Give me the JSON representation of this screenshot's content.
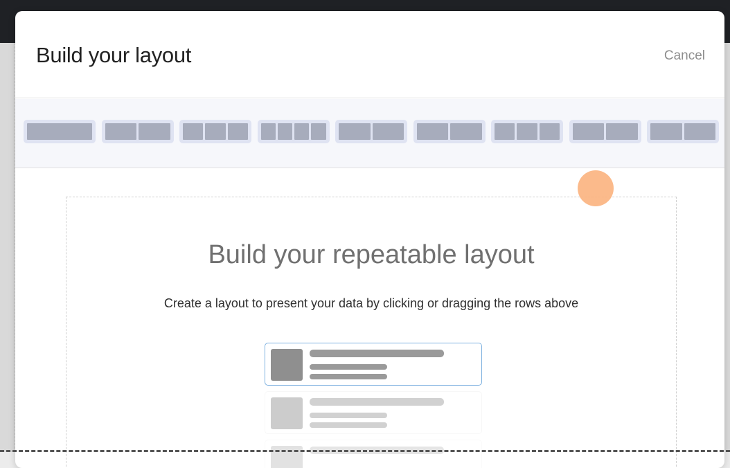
{
  "modal": {
    "title": "Build your layout",
    "cancel_label": "Cancel"
  },
  "palette": {
    "row_options": [
      {
        "name": "row-option-1",
        "segments": 1
      },
      {
        "name": "row-option-2",
        "segments": 2
      },
      {
        "name": "row-option-3",
        "segments": 3
      },
      {
        "name": "row-option-4",
        "segments": 4
      },
      {
        "name": "row-option-5",
        "segments": 2
      },
      {
        "name": "row-option-6",
        "segments": 2
      },
      {
        "name": "row-option-7",
        "segments": 3
      },
      {
        "name": "row-option-8",
        "segments": 2
      },
      {
        "name": "row-option-9",
        "segments": 2
      }
    ]
  },
  "canvas": {
    "title": "Build your repeatable layout",
    "subtitle": "Create a layout to present your data by clicking or dragging the rows above"
  },
  "colors": {
    "accent_border": "#7eb1e0",
    "cursor_highlight": "#fbb27e"
  }
}
